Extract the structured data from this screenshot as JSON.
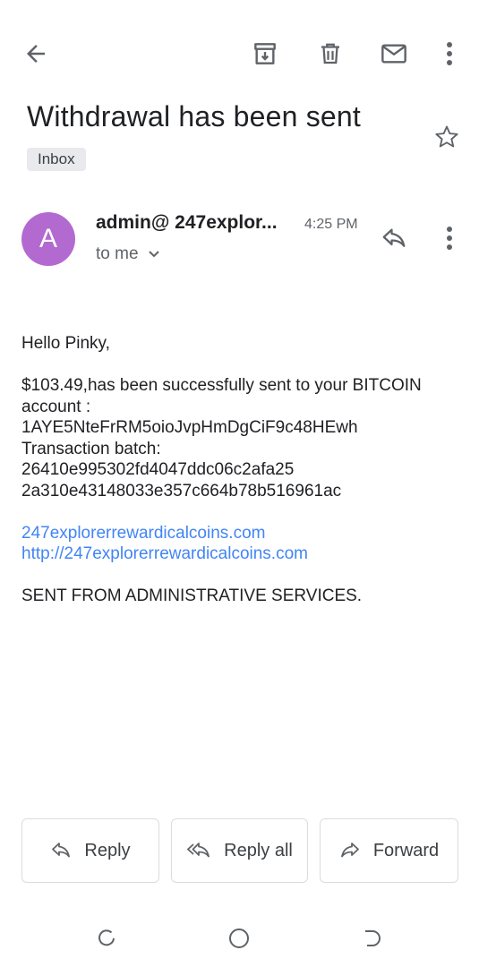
{
  "toolbar": {
    "back_icon": "arrow-back-icon",
    "archive_icon": "archive-icon",
    "delete_icon": "trash-icon",
    "mark_unread_icon": "mail-icon",
    "more_icon": "more-vert-icon"
  },
  "email": {
    "subject": "Withdrawal has been sent",
    "label": "Inbox",
    "starred": false,
    "sender_initial": "A",
    "sender_name": "admin@ 247explor...",
    "time": "4:25 PM",
    "recipient": "to me",
    "avatar_color": "#b36ad0",
    "body": {
      "greeting": "Hello Pinky,",
      "lines": [
        "$103.49,has been successfully sent to your BITCOIN",
        "account :",
        "1AYE5NteFrRM5oioJvpHmDgCiF9c48HEwh",
        "Transaction batch:",
        "26410e995302fd4047ddc06c2afa25",
        "2a310e43148033e357c664b78b516961ac"
      ],
      "links": [
        "247explorerrewardicalcoins.com",
        "http://247explorerrewardicalcoins.com"
      ],
      "signature": "SENT FROM ADMINISTRATIVE SERVICES."
    }
  },
  "actions": {
    "reply": "Reply",
    "reply_all": "Reply all",
    "forward": "Forward"
  },
  "colors": {
    "link": "#4285f4",
    "icon": "#5f6368"
  }
}
